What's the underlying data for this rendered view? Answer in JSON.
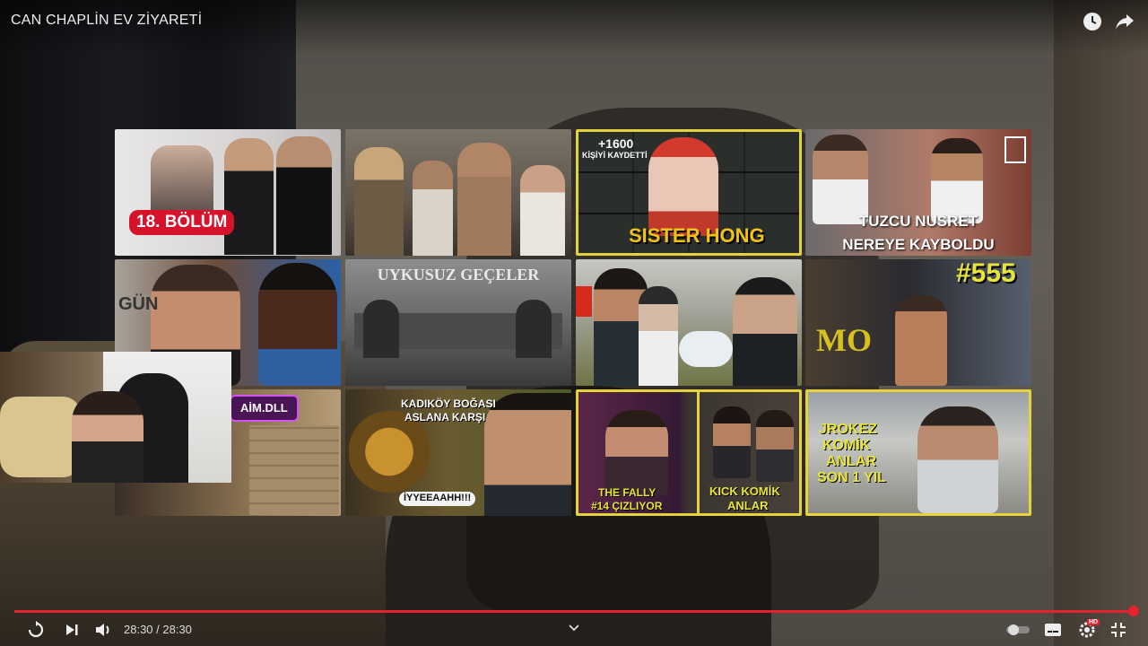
{
  "player": {
    "title": "CAN CHAPLİN EV ZİYARETİ",
    "time_display": "28:30 / 28:30",
    "progress": 1.0,
    "colors": {
      "progress": "#e5222f",
      "highlight_border": "#e5d23c"
    },
    "icons": [
      "watch-later-icon",
      "share-icon",
      "replay-icon",
      "next-icon",
      "volume-icon",
      "chevron-down-icon",
      "autoplay-toggle-icon",
      "subtitles-icon",
      "settings-icon",
      "fullscreen-exit-icon"
    ],
    "hd_badge": "HD"
  },
  "endscreen": {
    "cards": [
      {
        "text": [
          "18. BÖLÜM"
        ]
      },
      {
        "text": []
      },
      {
        "text": [
          "+1600",
          "KİŞİYİ KAYDETTİ",
          "SISTER HONG"
        ]
      },
      {
        "text": [
          "TUZCU NUSRET",
          "NEREYE KAYBOLDU"
        ]
      },
      {
        "text": [
          "GÜN"
        ]
      },
      {
        "text": [
          "UYKUSUZ GEÇELER"
        ]
      },
      {
        "text": []
      },
      {
        "text": [
          "#555",
          "MO"
        ]
      },
      {
        "text": [
          "AİM.DLL"
        ]
      },
      {
        "text": [
          "KADIKÖY BOĞASI",
          "ASLANA KARŞI",
          "İYYEEAAHH!!!"
        ]
      },
      {
        "text": [
          "THE FALLY",
          "#14 ÇIZLIYOR",
          "KICK KOMİK",
          "ANLAR"
        ]
      },
      {
        "text": [
          "JROKEZ",
          "KOMİK",
          "ANLAR",
          "SON 1 YIL"
        ]
      }
    ]
  }
}
